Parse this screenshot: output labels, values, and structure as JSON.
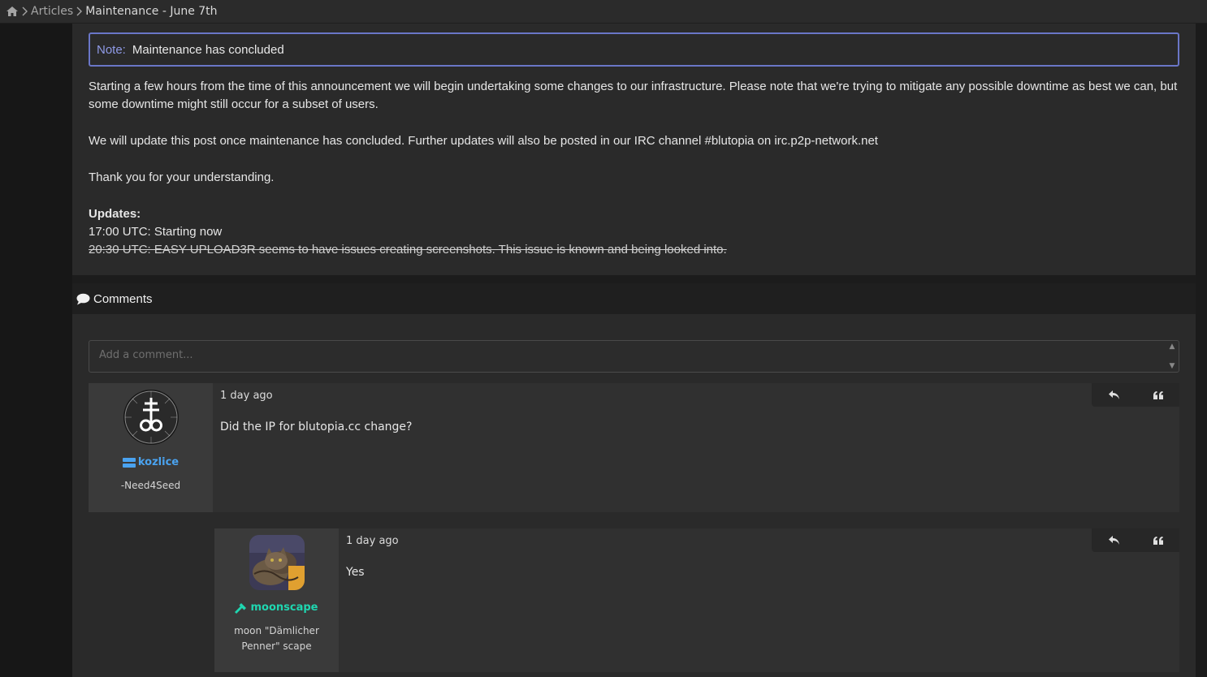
{
  "breadcrumb": {
    "home_icon": "home-icon",
    "items": [
      "Articles",
      "Maintenance - June 7th"
    ]
  },
  "note": {
    "label": "Note:",
    "text": "Maintenance has concluded"
  },
  "article": {
    "paragraph1": "Starting a few hours from the time of this announcement we will begin undertaking some changes to our infrastructure. Please note that we're trying to mitigate any possible downtime as best we can, but some downtime might still occur for a subset of users.",
    "paragraph2": "We will update this post once maintenance has concluded. Further updates will also be posted in our IRC channel #blutopia on irc.p2p-network.net",
    "paragraph3": "Thank you for your understanding.",
    "updates_heading": "Updates:",
    "update1": "17:00 UTC: Starting now",
    "update2": "20:30 UTC: EASY UPLOAD3R seems to have issues creating screenshots. This issue is known and being looked into."
  },
  "comments": {
    "header": "Comments",
    "input_placeholder": "Add a comment...",
    "list": [
      {
        "username": "kozlice",
        "user_title": "-Need4Seed",
        "time": "1 day ago",
        "content": "Did the IP for blutopia.cc change?",
        "username_color": "#4aa3f0"
      },
      {
        "username": "moonscape",
        "user_title_line1": "moon \"Dämlicher",
        "user_title_line2": "Penner\" scape",
        "time": "1 day ago",
        "content": "Yes",
        "username_color": "#1fd6b0"
      }
    ]
  },
  "colors": {
    "accent": "#6a76c7",
    "note_label": "#8f9ae6"
  }
}
